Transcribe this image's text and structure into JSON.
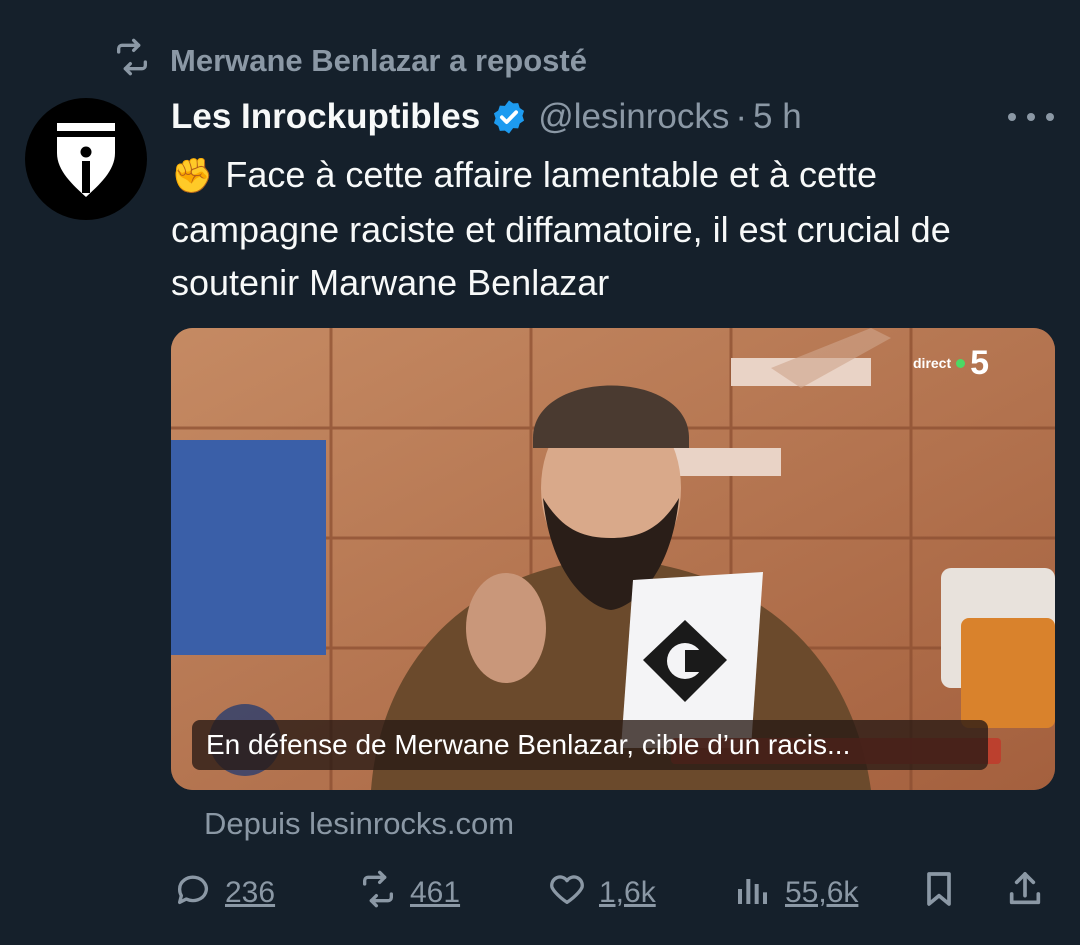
{
  "repost": {
    "text": "Merwane Benlazar a reposté",
    "icon": "repost-icon"
  },
  "author": {
    "display_name": "Les Inrockuptibles",
    "handle": "@lesinrocks",
    "separator": "·",
    "time": "5 h",
    "verified": true,
    "avatar_icon": "pen-nib-logo"
  },
  "tweet": {
    "emoji": "✊",
    "text": "Face à cette affaire lamentable et à cette campagne raciste et diffamatoire, il est crucial de soutenir Marwane Benlazar"
  },
  "media": {
    "channel_label": "direct",
    "channel_number": "5",
    "caption": "En défense de Merwane Benlazar, cible d’un racis..."
  },
  "link_source": "Depuis lesinrocks.com",
  "actions": {
    "replies": "236",
    "reposts": "461",
    "likes": "1,6k",
    "views": "55,6k"
  },
  "colors": {
    "background": "#15202b",
    "secondary_text": "#8b98a5",
    "verified_blue": "#1d9bf0"
  }
}
